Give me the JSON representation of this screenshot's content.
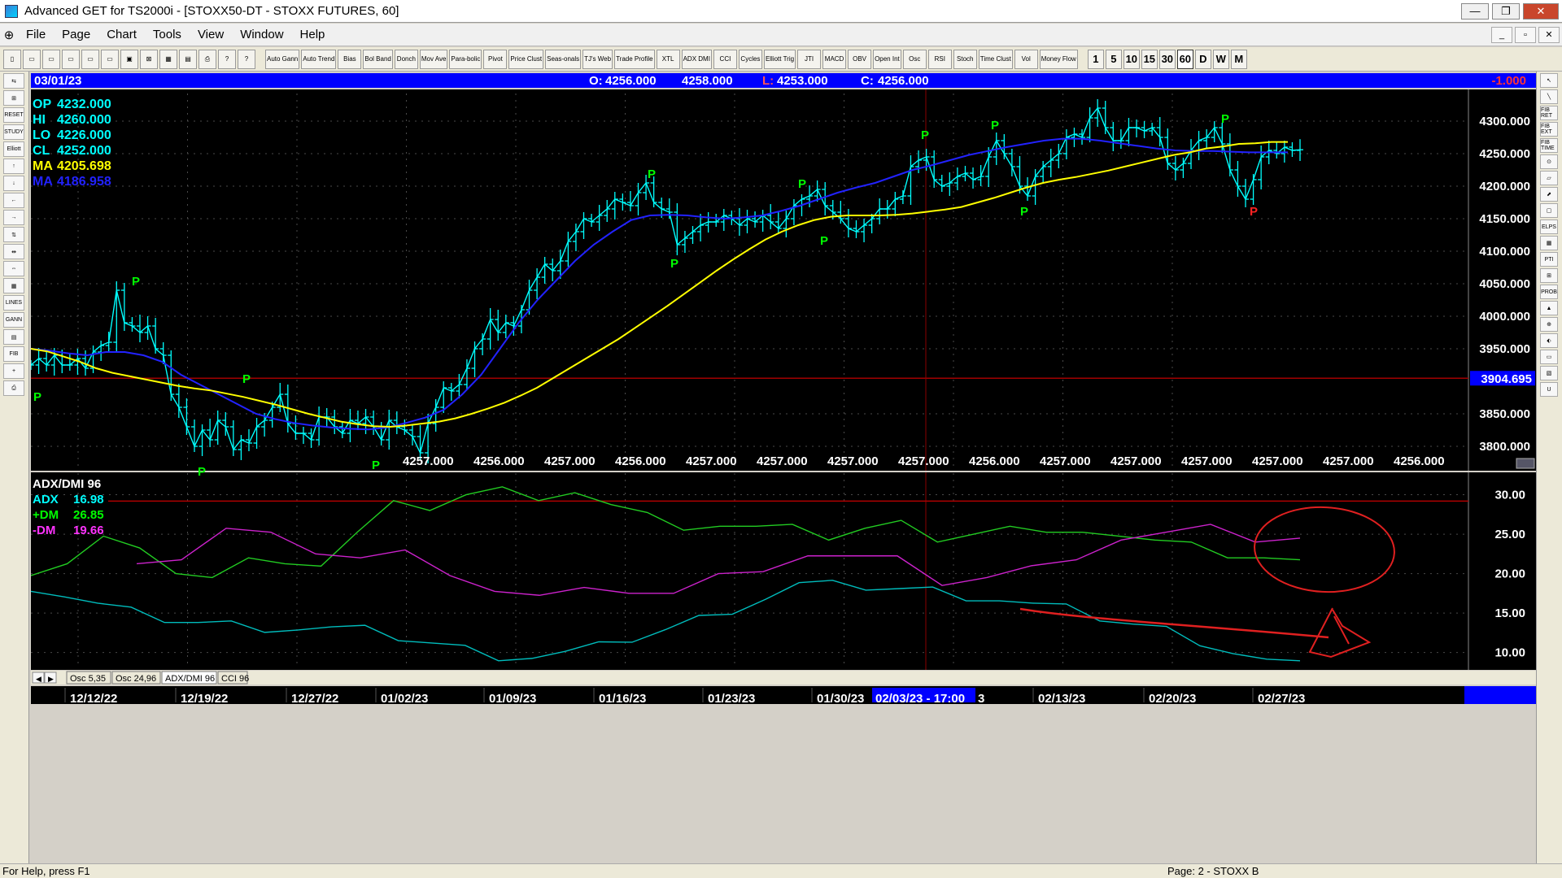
{
  "window": {
    "title": "Advanced GET for TS2000i - [STOXX50-DT - STOXX FUTURES, 60]"
  },
  "window_buttons": {
    "minimize": "—",
    "maximize": "❐",
    "close": "✕"
  },
  "menu": {
    "logo": "⊕",
    "items": [
      "File",
      "Page",
      "Chart",
      "Tools",
      "View",
      "Window",
      "Help"
    ],
    "mdi": [
      "_",
      "▫",
      "✕"
    ]
  },
  "toolbar": {
    "file_icons": [
      "▯",
      "▭",
      "▭",
      "▭",
      "▭",
      "▭",
      "▣",
      "⊠",
      "▦",
      "▤",
      "⎙",
      "?",
      "?"
    ],
    "study_buttons": [
      "Auto Gann",
      "Auto Trend",
      "Bias",
      "Bol Band",
      "Donch",
      "Mov Ave",
      "Para-bolic",
      "Pivot",
      "Price Clust",
      "Seas-onals",
      "TJ's Web",
      "Trade Profile",
      "XTL",
      "ADX DMI",
      "CCI",
      "Cycles",
      "Elliott Trig",
      "JTI",
      "MACD",
      "OBV",
      "Open Int",
      "Osc",
      "RSI",
      "Stoch",
      "Time Clust",
      "Vol",
      "Money Flow"
    ],
    "timeframes": [
      "1",
      "5",
      "10",
      "15",
      "30",
      "60",
      "D",
      "W",
      "M"
    ],
    "active_timeframe": "60"
  },
  "left_tools": [
    "⇆",
    "⊞",
    "RESET",
    "STUDY",
    "Elliott",
    "↑",
    "↓",
    "←",
    "→",
    "⇅",
    "⇹",
    "⇔",
    "▦",
    "LINES",
    "GANN",
    "▤",
    "FIB",
    "+",
    "⎙"
  ],
  "right_tools": [
    "↖",
    "╲",
    "FIB RET",
    "FIB EXT",
    "FIB TIME",
    "⊙",
    "▱",
    "⬈",
    "▢",
    "ELPS",
    "▦",
    "PTI",
    "⊞",
    "PROB",
    "▲",
    "⊕",
    "⬖",
    "▭",
    "▧",
    "U"
  ],
  "chart": {
    "date_label": "03/01/23",
    "o_label": "O:",
    "o_value": "4256.000",
    "h_value": "4258.000",
    "l_label": "L:",
    "l_value": "4253.000",
    "c_label": "C:",
    "c_value": "4256.000",
    "change": "-1.000",
    "legend": [
      {
        "label": "OP",
        "value": "4232.000",
        "color": "#00ffff"
      },
      {
        "label": "HI",
        "value": "4260.000",
        "color": "#00ffff"
      },
      {
        "label": "LO",
        "value": "4226.000",
        "color": "#00ffff"
      },
      {
        "label": "CL",
        "value": "4252.000",
        "color": "#00ffff"
      },
      {
        "label": "MA",
        "value": "4205.698",
        "color": "#ffff00"
      },
      {
        "label": "MA",
        "value": "4186.958",
        "color": "#2222ff"
      }
    ],
    "price_ticks": [
      "4300.000",
      "4250.000",
      "4200.000",
      "4150.000",
      "4100.000",
      "4050.000",
      "4000.000",
      "3950.000",
      "3900.000",
      "3850.000",
      "3800.000"
    ],
    "hline_label": "3904.695",
    "hline_value": 3904.695,
    "bottom_values": [
      "4257.000",
      "4256.000",
      "4257.000",
      "4256.000",
      "4257.000",
      "4257.000",
      "4257.000",
      "4257.000",
      "4256.000",
      "4257.000",
      "4257.000",
      "4257.000",
      "4257.000",
      "4257.000",
      "4256.000"
    ],
    "pivot_marker": "P"
  },
  "indicator": {
    "title": "ADX/DMI 96",
    "legend": [
      {
        "label": "ADX",
        "value": "16.98",
        "color": "#00ffff"
      },
      {
        "label": "+DM",
        "value": "26.85",
        "color": "#00ff00"
      },
      {
        "label": "-DM",
        "value": "19.66",
        "color": "#ff33ff"
      }
    ],
    "ticks": [
      "30.00",
      "25.00",
      "20.00",
      "15.00",
      "10.00"
    ],
    "tabs": [
      "Osc 5,35",
      "Osc 24,96",
      "ADX/DMI 96",
      "CCI 96"
    ],
    "tab_nav": [
      "◀",
      "▶"
    ],
    "active_tab": "ADX/DMI 96"
  },
  "date_axis": {
    "labels": [
      "12/12/22",
      "12/19/22",
      "12/27/22",
      "01/02/23",
      "01/09/23",
      "01/16/23",
      "01/23/23",
      "01/30/23",
      "02/13/23",
      "02/20/23",
      "02/27/23"
    ],
    "cursor_label": "02/03/23 - 17:00",
    "cursor_suffix": "3"
  },
  "status": {
    "help": "For Help, press F1",
    "page": "Page: 2 - STOXX B"
  },
  "colors": {
    "bull": "#00ffff",
    "ma_fast": "#ffff00",
    "ma_slow": "#2222ff",
    "dmplus": "#22cc22",
    "dmminus": "#cc22cc",
    "adx": "#00bcbc",
    "annot": "#e02020",
    "cursor": "#8b0000",
    "hline": "#a00000",
    "pivot_green": "#00ff00",
    "pivot_red": "#ff2222"
  },
  "chart_data": {
    "type": "line",
    "price": {
      "close": [
        3925,
        3935,
        3925,
        3940,
        3925,
        3925,
        3935,
        3920,
        3945,
        3955,
        3960,
        4040,
        3990,
        3985,
        3975,
        3985,
        3950,
        3940,
        3880,
        3860,
        3830,
        3800,
        3825,
        3810,
        3840,
        3830,
        3795,
        3810,
        3805,
        3830,
        3840,
        3860,
        3880,
        3835,
        3820,
        3820,
        3810,
        3845,
        3845,
        3830,
        3820,
        3840,
        3835,
        3845,
        3830,
        3810,
        3840,
        3830,
        3825,
        3815,
        3790,
        3835,
        3860,
        3890,
        3885,
        3895,
        3920,
        3950,
        3965,
        3995,
        3975,
        3990,
        3985,
        4010,
        4040,
        4060,
        4080,
        4070,
        4085,
        4115,
        4130,
        4150,
        4145,
        4155,
        4165,
        4180,
        4175,
        4170,
        4190,
        4205,
        4175,
        4165,
        4160,
        4110,
        4120,
        4130,
        4140,
        4145,
        4145,
        4155,
        4150,
        4140,
        4150,
        4145,
        4155,
        4145,
        4135,
        4150,
        4170,
        4180,
        4185,
        4195,
        4170,
        4160,
        4150,
        4135,
        4130,
        4140,
        4150,
        4165,
        4165,
        4180,
        4185,
        4230,
        4240,
        4245,
        4210,
        4200,
        4205,
        4215,
        4220,
        4210,
        4215,
        4245,
        4270,
        4250,
        4230,
        4200,
        4185,
        4215,
        4230,
        4240,
        4250,
        4275,
        4280,
        4275,
        4305,
        4320,
        4290,
        4270,
        4270,
        4290,
        4290,
        4285,
        4290,
        4275,
        4235,
        4225,
        4235,
        4255,
        4270,
        4275,
        4290,
        4265,
        4225,
        4200,
        4180,
        4210,
        4245,
        4255,
        4250,
        4260,
        4255,
        4256
      ],
      "ma_fast": [
        3950,
        3946,
        3938,
        3930,
        3920,
        3913,
        3908,
        3903,
        3898,
        3893,
        3889,
        3886,
        3881,
        3876,
        3870,
        3864,
        3857,
        3850,
        3844,
        3838,
        3834,
        3831,
        3830,
        3832,
        3835,
        3838,
        3843,
        3850,
        3858,
        3867,
        3878,
        3890,
        3905,
        3920,
        3935,
        3950,
        3965,
        3982,
        3999,
        4016,
        4034,
        4052,
        4070,
        4087,
        4103,
        4118,
        4130,
        4140,
        4148,
        4153,
        4155,
        4155,
        4155,
        4156,
        4158,
        4161,
        4164,
        4168,
        4175,
        4182,
        4190,
        4198,
        4205,
        4210,
        4214,
        4219,
        4224,
        4230,
        4236,
        4242,
        4248,
        4252,
        4258,
        4261,
        4265,
        4266,
        4268,
        4268
      ],
      "ma_slow": [
        3950,
        3947,
        3943,
        3940,
        3945,
        3945,
        3940,
        3930,
        3910,
        3895,
        3880,
        3865,
        3850,
        3842,
        3836,
        3832,
        3829,
        3827,
        3826,
        3829,
        3836,
        3844,
        3856,
        3880,
        3910,
        3950,
        3990,
        4025,
        4055,
        4085,
        4110,
        4130,
        4148,
        4155,
        4156,
        4155,
        4152,
        4150,
        4152,
        4155,
        4162,
        4170,
        4180,
        4190,
        4198,
        4205,
        4215,
        4225,
        4232,
        4240,
        4248,
        4254,
        4260,
        4265,
        4270,
        4273,
        4273,
        4270,
        4266,
        4262,
        4258,
        4255,
        4254,
        4254,
        4253,
        4252,
        4252,
        4252
      ]
    },
    "pivots": {
      "high": [
        [
          "12/12/22",
          4040
        ],
        [
          "12/19/22",
          3890
        ],
        [
          "01/16/23",
          4205
        ],
        [
          "01/23/23",
          4190
        ],
        [
          "02/03/23",
          4265
        ],
        [
          "02/06/23",
          4280
        ],
        [
          "02/23/23",
          4290
        ]
      ],
      "low": [
        [
          "12/08/22",
          3890
        ],
        [
          "12/16/22",
          3775
        ],
        [
          "12/29/22",
          3785
        ],
        [
          "01/17/23",
          4095
        ],
        [
          "01/26/23",
          4130
        ],
        [
          "02/08/23",
          4175
        ],
        [
          "02/27/23",
          4175
        ]
      ]
    },
    "adx_dmi": {
      "adx": [
        18.5,
        17.3,
        16,
        15,
        14.3,
        13.8,
        13.5,
        13.3,
        13.1,
        13,
        12.7,
        12,
        11.2,
        10.4,
        9.7,
        9.5,
        9.9,
        10.6,
        11.8,
        12.9,
        14.2,
        15.6,
        17,
        18.6,
        18.4,
        18.4,
        18.1,
        17.8,
        17.3,
        16.8,
        16,
        15.4,
        14.5,
        13.6,
        12.8,
        11.6,
        10.1,
        8.9,
        8.2
      ],
      "dm_plus": [
        20.5,
        21.5,
        24.5,
        22.5,
        20.5,
        19.5,
        21.5,
        22,
        21.2,
        25,
        28.5,
        28.5,
        30,
        30.5,
        30,
        30.5,
        28.5,
        27,
        26,
        26,
        25.5,
        27,
        24.5,
        25.5,
        26,
        24.5,
        25,
        25.5,
        26,
        25.5,
        24.5,
        23.5,
        24.5,
        22,
        21.5,
        22.5
      ],
      "dm_minus": [
        22,
        22,
        25.5,
        24.5,
        23,
        22,
        22.5,
        20.5,
        18,
        17,
        17.5,
        18,
        17.5,
        19.5,
        21,
        22.5,
        22,
        21.5,
        19,
        19.5,
        20.5,
        22.5,
        24.5,
        25,
        25.5,
        24.5,
        24.5
      ],
      "guide": 29.2
    },
    "ylim_price": [
      3765,
      4330
    ],
    "ylim_adx": [
      8,
      31.5
    ]
  }
}
